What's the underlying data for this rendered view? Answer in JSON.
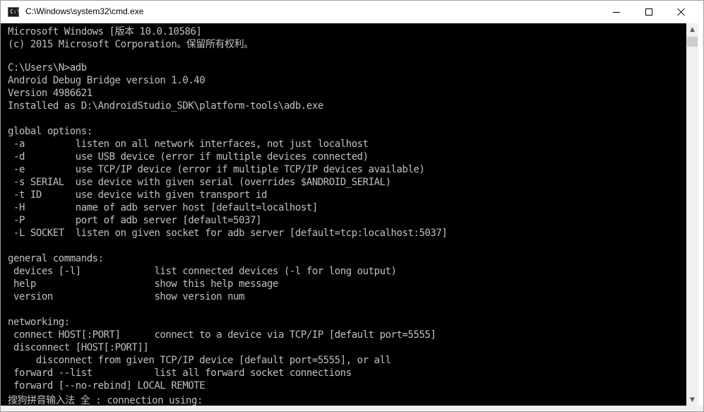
{
  "window": {
    "title": "C:\\Windows\\system32\\cmd.exe"
  },
  "icons": {
    "app": "command-prompt-icon",
    "minimize": "minimize-icon",
    "maximize": "maximize-icon",
    "close": "close-icon",
    "scroll_up": "arrow-up-icon",
    "scroll_down": "arrow-down-icon"
  },
  "colors": {
    "console_background": "#000000",
    "console_text": "#c0c0c0"
  },
  "console": {
    "lines": [
      "Microsoft Windows [版本 10.0.10586]",
      "(c) 2015 Microsoft Corporation。保留所有权利。",
      "",
      "C:\\Users\\N>adb",
      "Android Debug Bridge version 1.0.40",
      "Version 4986621",
      "Installed as D:\\AndroidStudio_SDK\\platform-tools\\adb.exe",
      "",
      "global options:",
      " -a         listen on all network interfaces, not just localhost",
      " -d         use USB device (error if multiple devices connected)",
      " -e         use TCP/IP device (error if multiple TCP/IP devices available)",
      " -s SERIAL  use device with given serial (overrides $ANDROID_SERIAL)",
      " -t ID      use device with given transport id",
      " -H         name of adb server host [default=localhost]",
      " -P         port of adb server [default=5037]",
      " -L SOCKET  listen on given socket for adb server [default=tcp:localhost:5037]",
      "",
      "general commands:",
      " devices [-l]             list connected devices (-l for long output)",
      " help                     show this help message",
      " version                  show version num",
      "",
      "networking:",
      " connect HOST[:PORT]      connect to a device via TCP/IP [default port=5555]",
      " disconnect [HOST[:PORT]]",
      "     disconnect from given TCP/IP device [default port=5555], or all",
      " forward --list           list all forward socket connections",
      " forward [--no-rebind] LOCAL REMOTE",
      "搜狗拼音输入法 全 : connection using:"
    ]
  }
}
